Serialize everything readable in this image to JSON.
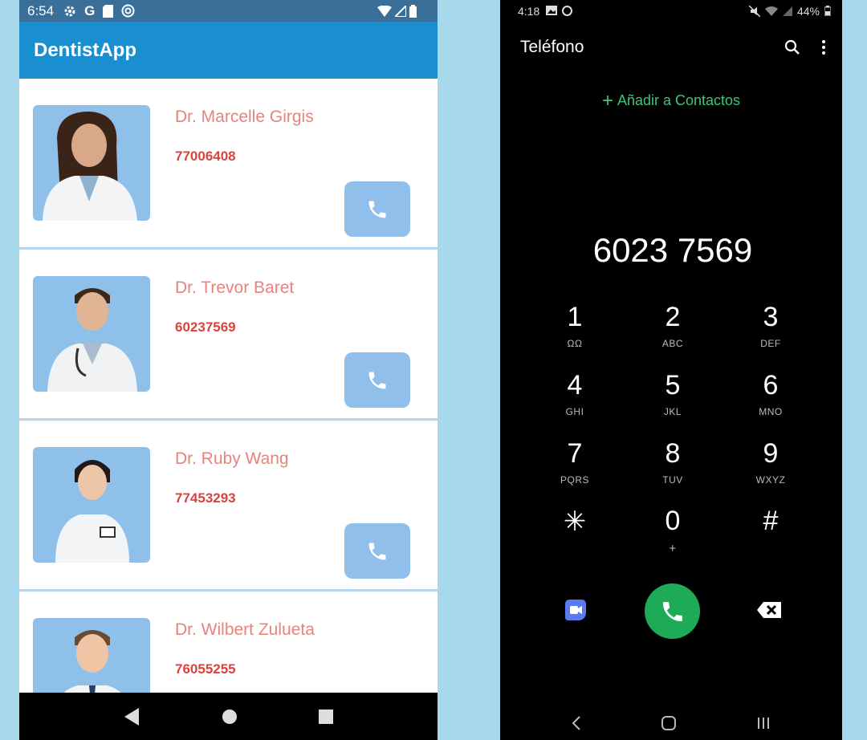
{
  "left": {
    "status_bar": {
      "time": "6:54",
      "icons": [
        "gear-icon",
        "google-icon",
        "sd-card-icon",
        "at-icon"
      ],
      "right_icons": [
        "wifi-icon",
        "signal-icon",
        "battery-icon"
      ]
    },
    "app_title": "DentistApp",
    "dentists": [
      {
        "name": "Dr. Marcelle Girgis",
        "phone": "77006408"
      },
      {
        "name": "Dr. Trevor Baret",
        "phone": "60237569"
      },
      {
        "name": "Dr. Ruby Wang",
        "phone": "77453293"
      },
      {
        "name": "Dr. Wilbert Zulueta",
        "phone": "76055255"
      }
    ],
    "nav": [
      "back-icon",
      "home-icon",
      "recents-icon"
    ]
  },
  "right": {
    "status_bar": {
      "time": "4:18",
      "battery": "44%"
    },
    "header_title": "Teléfono",
    "add_contact": "Añadir a Contactos",
    "dialed_number": "6023 7569",
    "keypad": [
      {
        "digit": "1",
        "letters": "ΩΩ"
      },
      {
        "digit": "2",
        "letters": "ABC"
      },
      {
        "digit": "3",
        "letters": "DEF"
      },
      {
        "digit": "4",
        "letters": "GHI"
      },
      {
        "digit": "5",
        "letters": "JKL"
      },
      {
        "digit": "6",
        "letters": "MNO"
      },
      {
        "digit": "7",
        "letters": "PQRS"
      },
      {
        "digit": "8",
        "letters": "TUV"
      },
      {
        "digit": "9",
        "letters": "WXYZ"
      },
      {
        "digit": "✳",
        "letters": ""
      },
      {
        "digit": "0",
        "letters": "+"
      },
      {
        "digit": "#",
        "letters": ""
      }
    ],
    "colors": {
      "call_green": "#1dab57",
      "accent_green": "#3fc57a"
    }
  }
}
